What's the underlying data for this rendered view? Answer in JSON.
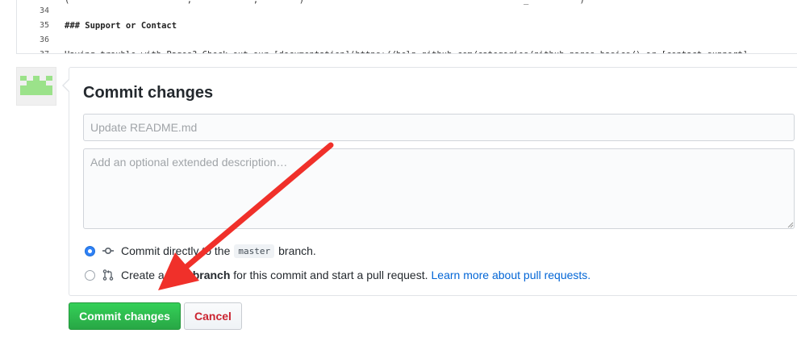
{
  "editor": {
    "lines": [
      {
        "number": "",
        "text": "(                       ,            ,        )                                           _          )                        "
      },
      {
        "number": "34",
        "text": ""
      },
      {
        "number": "35",
        "text": "### Support or Contact"
      },
      {
        "number": "36",
        "text": ""
      },
      {
        "number": "37",
        "text": "Having trouble with Pages? Check out our [documentation](https://help.github.com/categories/github-pages-basics/) or [contact support]"
      }
    ]
  },
  "commit": {
    "title": "Commit changes",
    "summary_placeholder": "Update README.md",
    "summary_value": "",
    "description_placeholder": "Add an optional extended description…",
    "option_direct": {
      "before": "Commit directly to the",
      "branch": "master",
      "after": "branch.",
      "selected": true
    },
    "option_new_branch": {
      "before": "Create a",
      "bold": "new branch",
      "after": "for this commit and start a pull request.",
      "link": "Learn more about pull requests.",
      "selected": false
    }
  },
  "buttons": {
    "commit_label": "Commit changes",
    "cancel_label": "Cancel"
  },
  "icons": {
    "avatar": "identicon-avatar",
    "commit": "git-commit-icon",
    "pull_request": "git-pull-request-icon"
  },
  "colors": {
    "primary_button": "#28a745",
    "cancel_text": "#cb2431",
    "link": "#0366d6",
    "annotation_arrow": "#f0302a",
    "avatar_green": "#9be28a"
  }
}
